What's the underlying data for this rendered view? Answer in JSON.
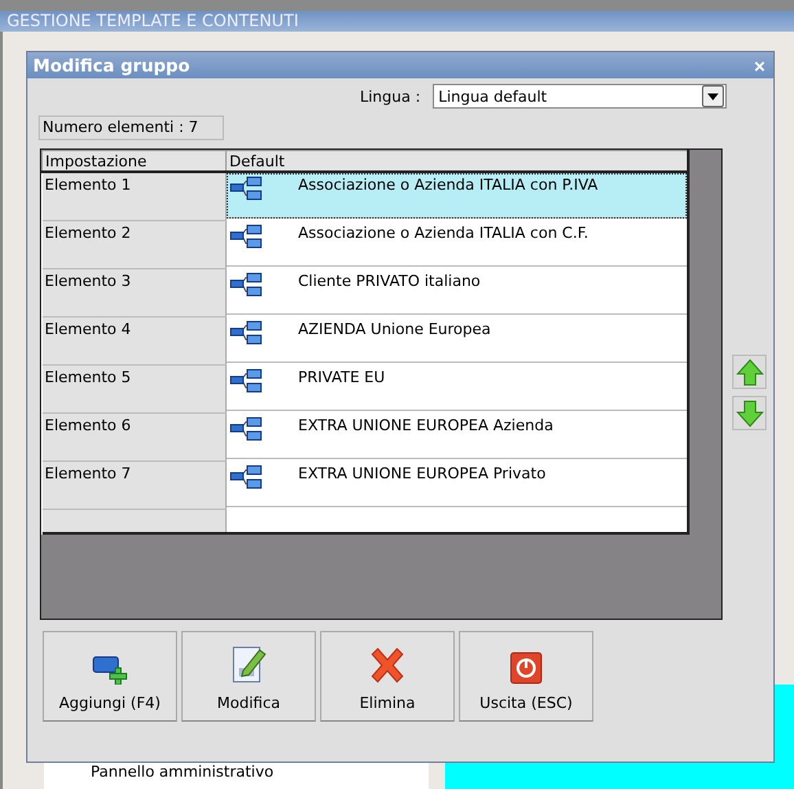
{
  "background_window": {
    "title": "GESTIONE TEMPLATE E CONTENUTI",
    "tree_items": [
      "Pannello amministrativo"
    ]
  },
  "dialog": {
    "title": "Modifica gruppo",
    "close": "×",
    "language_label": "Lingua :",
    "language_value": "Lingua default",
    "count_label": "Numero elementi : 7",
    "table": {
      "columns": [
        "Impostazione",
        "Default"
      ],
      "rows": [
        {
          "setting": "Elemento 1",
          "value": "Associazione o Azienda ITALIA con P.IVA",
          "selected": true
        },
        {
          "setting": "Elemento 2",
          "value": "Associazione o Azienda ITALIA con C.F.",
          "selected": false
        },
        {
          "setting": "Elemento 3",
          "value": "Cliente PRIVATO italiano",
          "selected": false
        },
        {
          "setting": "Elemento 4",
          "value": "AZIENDA Unione Europea",
          "selected": false
        },
        {
          "setting": "Elemento 5",
          "value": "PRIVATE EU",
          "selected": false
        },
        {
          "setting": "Elemento 6",
          "value": "EXTRA UNIONE EUROPEA Azienda",
          "selected": false
        },
        {
          "setting": "Elemento 7",
          "value": "EXTRA UNIONE EUROPEA Privato",
          "selected": false
        }
      ]
    },
    "buttons": [
      {
        "label": "Aggiungi (F4)",
        "kind": "add"
      },
      {
        "label": "Modifica",
        "kind": "edit"
      },
      {
        "label": "Elimina",
        "kind": "delete"
      },
      {
        "label": "Uscita (ESC)",
        "kind": "exit"
      }
    ]
  }
}
